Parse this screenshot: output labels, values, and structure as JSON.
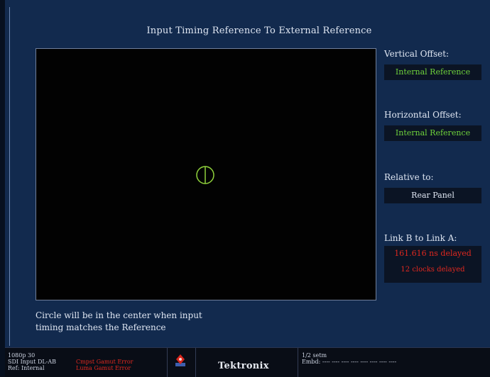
{
  "display": {
    "title": "Input Timing Reference To External Reference",
    "caption_line1": "Circle will be in the center when input",
    "caption_line2": "timing matches the Reference"
  },
  "readouts": {
    "vertical_offset": {
      "label": "Vertical Offset:",
      "value": "Internal Reference",
      "color": "#6ed13b"
    },
    "horizontal_offset": {
      "label": "Horizontal Offset:",
      "value": "Internal Reference",
      "color": "#6ed13b"
    },
    "relative_to": {
      "label": "Relative to:",
      "value": "Rear Panel"
    },
    "link_b_to_a": {
      "label": "Link B to Link A:",
      "delay_time": "161.616 ns delayed",
      "delay_clocks": "12 clocks delayed",
      "color": "#e0281f"
    }
  },
  "timing_marker": {
    "icon": "target-circle-icon",
    "color": "#8fd13b"
  },
  "status_bar": {
    "line1": "1080p 30",
    "line2": "SDI Input DL-AB",
    "line3": "Ref: Internal",
    "error1": "Cmpst Gamut Error",
    "error2": "Luma Gamut Error",
    "brand": "Tektronix",
    "right_line1": "1/2 setm",
    "right_line2": "Embd: ---- ---- ---- ---- ---- ---- ---- ----"
  }
}
